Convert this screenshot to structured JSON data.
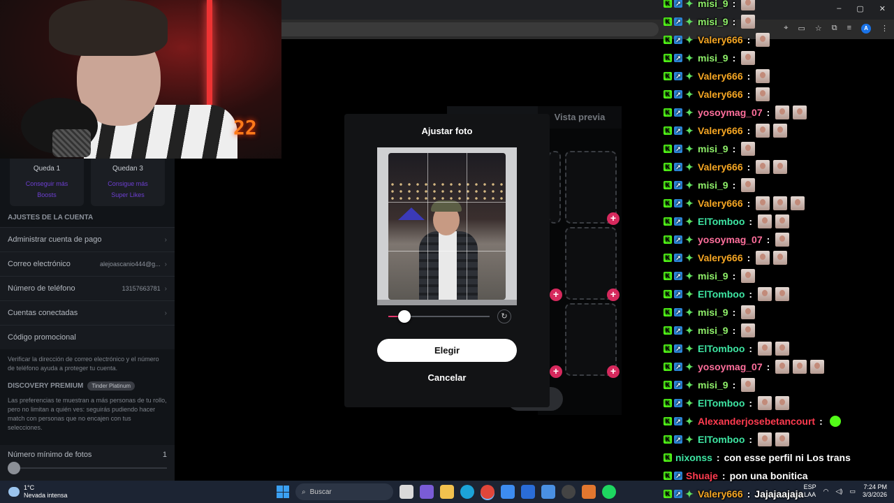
{
  "webcam": {
    "counter": "22"
  },
  "browser": {
    "window_controls": [
      "–",
      "▢",
      "✕"
    ],
    "profile_initial": "A"
  },
  "tinder": {
    "boosts": [
      {
        "title": "Queda 1",
        "link": "Conseguir más",
        "link2": "Boosts"
      },
      {
        "title": "Quedan 3",
        "link": "Consigue más",
        "link2": "Super Likes"
      }
    ],
    "account_header": "AJUSTES DE LA CUENTA",
    "rows": [
      {
        "label": "Administrar cuenta de pago",
        "value": ""
      },
      {
        "label": "Correo electrónico",
        "value": "alejoascanio444@g..."
      },
      {
        "label": "Número de teléfono",
        "value": "13157663781"
      },
      {
        "label": "Cuentas conectadas",
        "value": ""
      },
      {
        "label": "Código promocional",
        "value": ""
      }
    ],
    "verify_note": "Verificar la dirección de correo electrónico y el número de teléfono ayuda a proteger tu cuenta.",
    "discovery_header": "DISCOVERY PREMIUM",
    "platinum_badge": "Tinder Platinum",
    "discovery_note": "Las preferencias te muestran a más personas de tu rollo, pero no limitan a quién ves: seguirás pudiendo hacer match con personas que no encajen con tus selecciones.",
    "min_photos_label": "Número mínimo de fotos",
    "min_photos_value": "1",
    "preview_tab": "Vista previa"
  },
  "modal": {
    "title": "Ajustar foto",
    "zoom_fraction": 0.16,
    "choose": "Elegir",
    "cancel": "Cancelar"
  },
  "chat": [
    {
      "user": "misi_9",
      "color": "#8ff06a",
      "emotes": 1,
      "text": ""
    },
    {
      "user": "misi_9",
      "color": "#8ff06a",
      "emotes": 1,
      "text": ""
    },
    {
      "user": "Valery666",
      "color": "#f5a623",
      "emotes": 1,
      "text": ""
    },
    {
      "user": "misi_9",
      "color": "#8ff06a",
      "emotes": 1,
      "text": ""
    },
    {
      "user": "Valery666",
      "color": "#f5a623",
      "emotes": 1,
      "text": ""
    },
    {
      "user": "Valery666",
      "color": "#f5a623",
      "emotes": 1,
      "text": ""
    },
    {
      "user": "yosoymag_07",
      "color": "#ff6f9c",
      "emotes": 2,
      "text": ""
    },
    {
      "user": "Valery666",
      "color": "#f5a623",
      "emotes": 2,
      "text": ""
    },
    {
      "user": "misi_9",
      "color": "#8ff06a",
      "emotes": 1,
      "text": ""
    },
    {
      "user": "Valery666",
      "color": "#f5a623",
      "emotes": 2,
      "text": ""
    },
    {
      "user": "misi_9",
      "color": "#8ff06a",
      "emotes": 1,
      "text": ""
    },
    {
      "user": "Valery666",
      "color": "#f5a623",
      "emotes": 3,
      "text": ""
    },
    {
      "user": "ElTomboo",
      "color": "#3ee6a3",
      "emotes": 2,
      "text": ""
    },
    {
      "user": "yosoymag_07",
      "color": "#ff6f9c",
      "emotes": 1,
      "text": ""
    },
    {
      "user": "Valery666",
      "color": "#f5a623",
      "emotes": 2,
      "text": ""
    },
    {
      "user": "misi_9",
      "color": "#8ff06a",
      "emotes": 1,
      "text": ""
    },
    {
      "user": "ElTomboo",
      "color": "#3ee6a3",
      "emotes": 2,
      "text": ""
    },
    {
      "user": "misi_9",
      "color": "#8ff06a",
      "emotes": 1,
      "text": ""
    },
    {
      "user": "misi_9",
      "color": "#8ff06a",
      "emotes": 1,
      "text": ""
    },
    {
      "user": "ElTomboo",
      "color": "#3ee6a3",
      "emotes": 2,
      "text": ""
    },
    {
      "user": "yosoymag_07",
      "color": "#ff6f9c",
      "emotes": 3,
      "text": ""
    },
    {
      "user": "misi_9",
      "color": "#8ff06a",
      "emotes": 1,
      "text": ""
    },
    {
      "user": "ElTomboo",
      "color": "#3ee6a3",
      "emotes": 2,
      "text": ""
    },
    {
      "user": "Alexanderjosebetancourt",
      "color": "#ff3b4f",
      "emotes": 0,
      "green": true,
      "text": ""
    },
    {
      "user": "ElTomboo",
      "color": "#3ee6a3",
      "emotes": 2,
      "text": ""
    },
    {
      "user": "nixonss",
      "color": "#3ee6a3",
      "emotes": 0,
      "text": "con esse perfil ni Los trans",
      "badges": "k"
    },
    {
      "user": "Shuaje",
      "color": "#ff3b4f",
      "emotes": 0,
      "text": "pon una bonitica",
      "badges": "km"
    },
    {
      "user": "Valery666",
      "color": "#f5a623",
      "emotes": 0,
      "text": "Jajajaajaja"
    }
  ],
  "taskbar": {
    "temp": "1°C",
    "weather": "Nevada intensa",
    "search": "Buscar",
    "lang1": "ESP",
    "lang2": "LAA",
    "time": "7:24 PM",
    "date": "3/3/2026"
  }
}
